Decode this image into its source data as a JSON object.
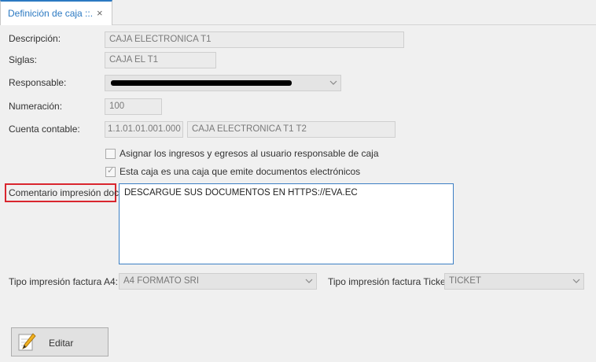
{
  "tab": {
    "title": "Definición de caja ::.",
    "close": "×"
  },
  "form": {
    "descripcion": {
      "label": "Descripción:",
      "value": "CAJA ELECTRONICA T1"
    },
    "siglas": {
      "label": "Siglas:",
      "value": "CAJA EL T1"
    },
    "responsable": {
      "label": "Responsable:",
      "value": ""
    },
    "numeracion": {
      "label": "Numeración:",
      "value": "100"
    },
    "cuenta": {
      "label": "Cuenta contable:",
      "code": "1.1.01.01.001.000",
      "name": "CAJA ELECTRONICA T1 T2"
    },
    "asignar": {
      "label": "Asignar los ingresos y egresos al usuario responsable de caja",
      "checked": false
    },
    "electronica": {
      "label": "Esta caja es una caja que emite documentos electrónicos",
      "checked": true
    },
    "comentario": {
      "label": "Comentario impresión docs:",
      "value": "DESCARGUE SUS DOCUMENTOS EN HTTPS://EVA.EC"
    },
    "tipo_a4": {
      "label": "Tipo impresión factura A4:",
      "value": "A4 FORMATO SRI"
    },
    "tipo_tickets": {
      "label": "Tipo impresión factura Tickets:",
      "value": "TICKET"
    }
  },
  "toolbar": {
    "edit_label": "Editar"
  },
  "colors": {
    "accent": "#2b79c2",
    "highlight": "#d9262e"
  }
}
